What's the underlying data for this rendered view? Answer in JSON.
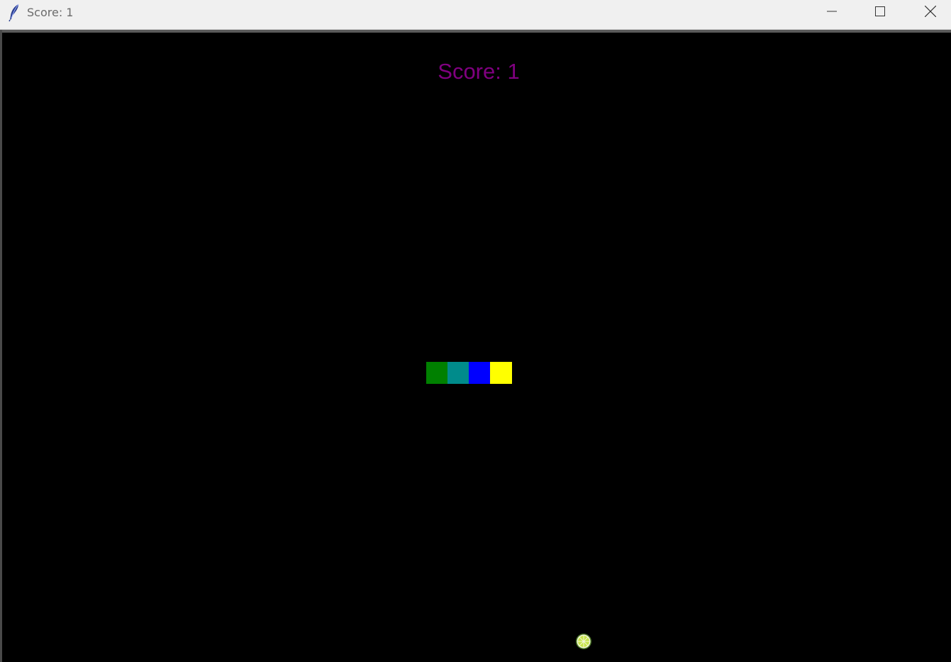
{
  "window": {
    "title": "Score: 1",
    "controls": {
      "minimize": "minimize-icon",
      "maximize": "maximize-icon",
      "close": "close-icon"
    },
    "icon": "feather-icon"
  },
  "game": {
    "score_text": "Score: 1",
    "score_color": "#800080",
    "background_color": "#000000",
    "snake": {
      "direction": "right",
      "segments": [
        {
          "part": "tail",
          "color": "#008000"
        },
        {
          "part": "body",
          "color": "#008b8b"
        },
        {
          "part": "body",
          "color": "#0000ff"
        },
        {
          "part": "head",
          "color": "#ffff00"
        }
      ]
    },
    "food": {
      "icon": "lime-slice-icon",
      "color": "#c7e64a"
    }
  }
}
